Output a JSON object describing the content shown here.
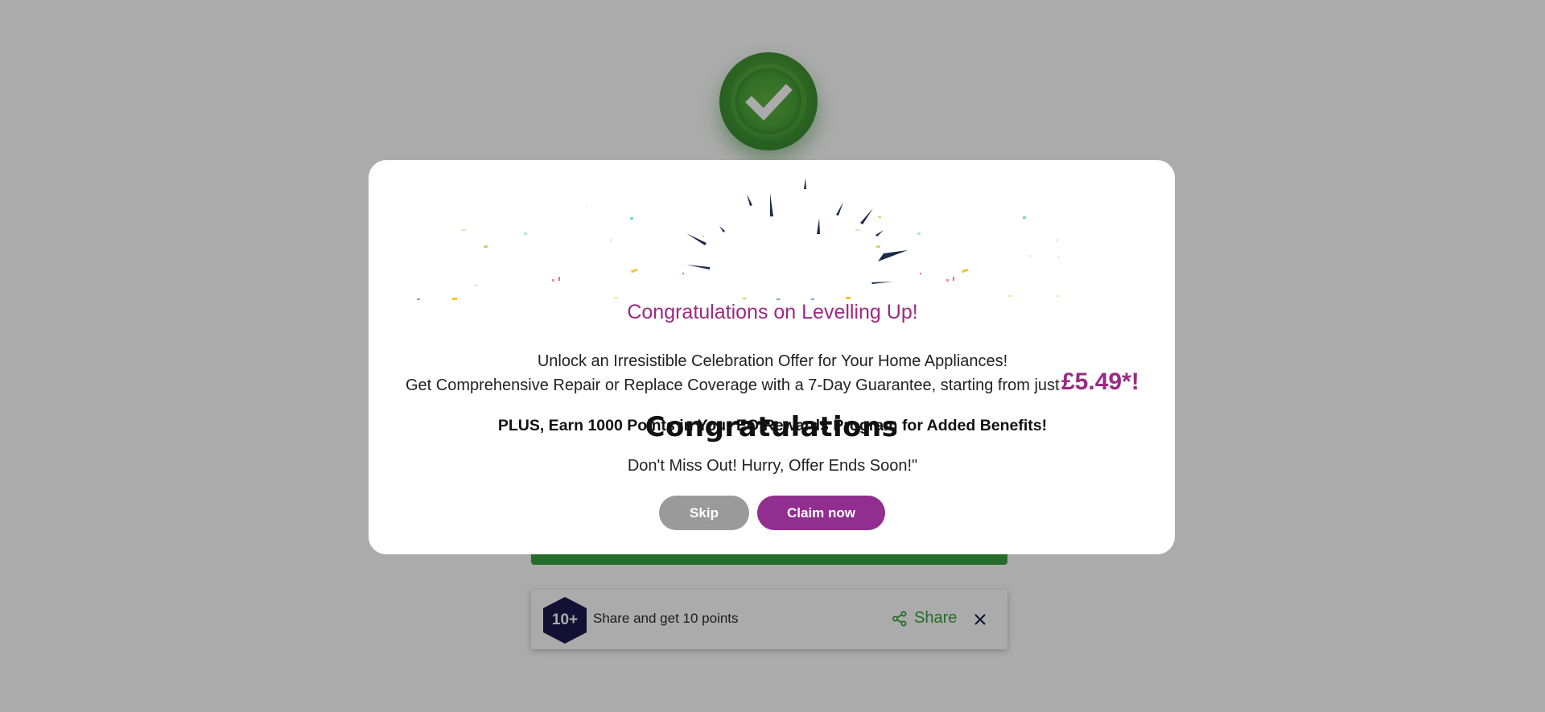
{
  "background": {
    "success_icon": "check-circle-icon",
    "share_card": {
      "badge_label": "10+",
      "text": "Share and get 10 points",
      "share_label": "Share",
      "share_icon": "share-icon",
      "close_icon": "close-icon",
      "accent_color": "#3aa23f",
      "badge_color": "#1c1a4e"
    }
  },
  "modal": {
    "title": "Congratulations",
    "subtitle": "Congratulations on Levelling Up!",
    "offer_line_1": "Unlock an Irresistible Celebration Offer for Your Home Appliances!",
    "offer_line_2": "Get Comprehensive Repair or Replace Coverage with a 7-Day Guarantee, starting from just",
    "price": "£5.49*!",
    "plus_line": "PLUS, Earn 1000 Points in Your EO Rewards Program for Added Benefits!",
    "hurry_line": "Don't Miss Out! Hurry, Offer Ends Soon!\"",
    "skip_label": "Skip",
    "claim_label": "Claim now",
    "accent_color": "#9b2a82",
    "claim_color": "#922e8f",
    "skip_color": "#9a9a9a"
  }
}
